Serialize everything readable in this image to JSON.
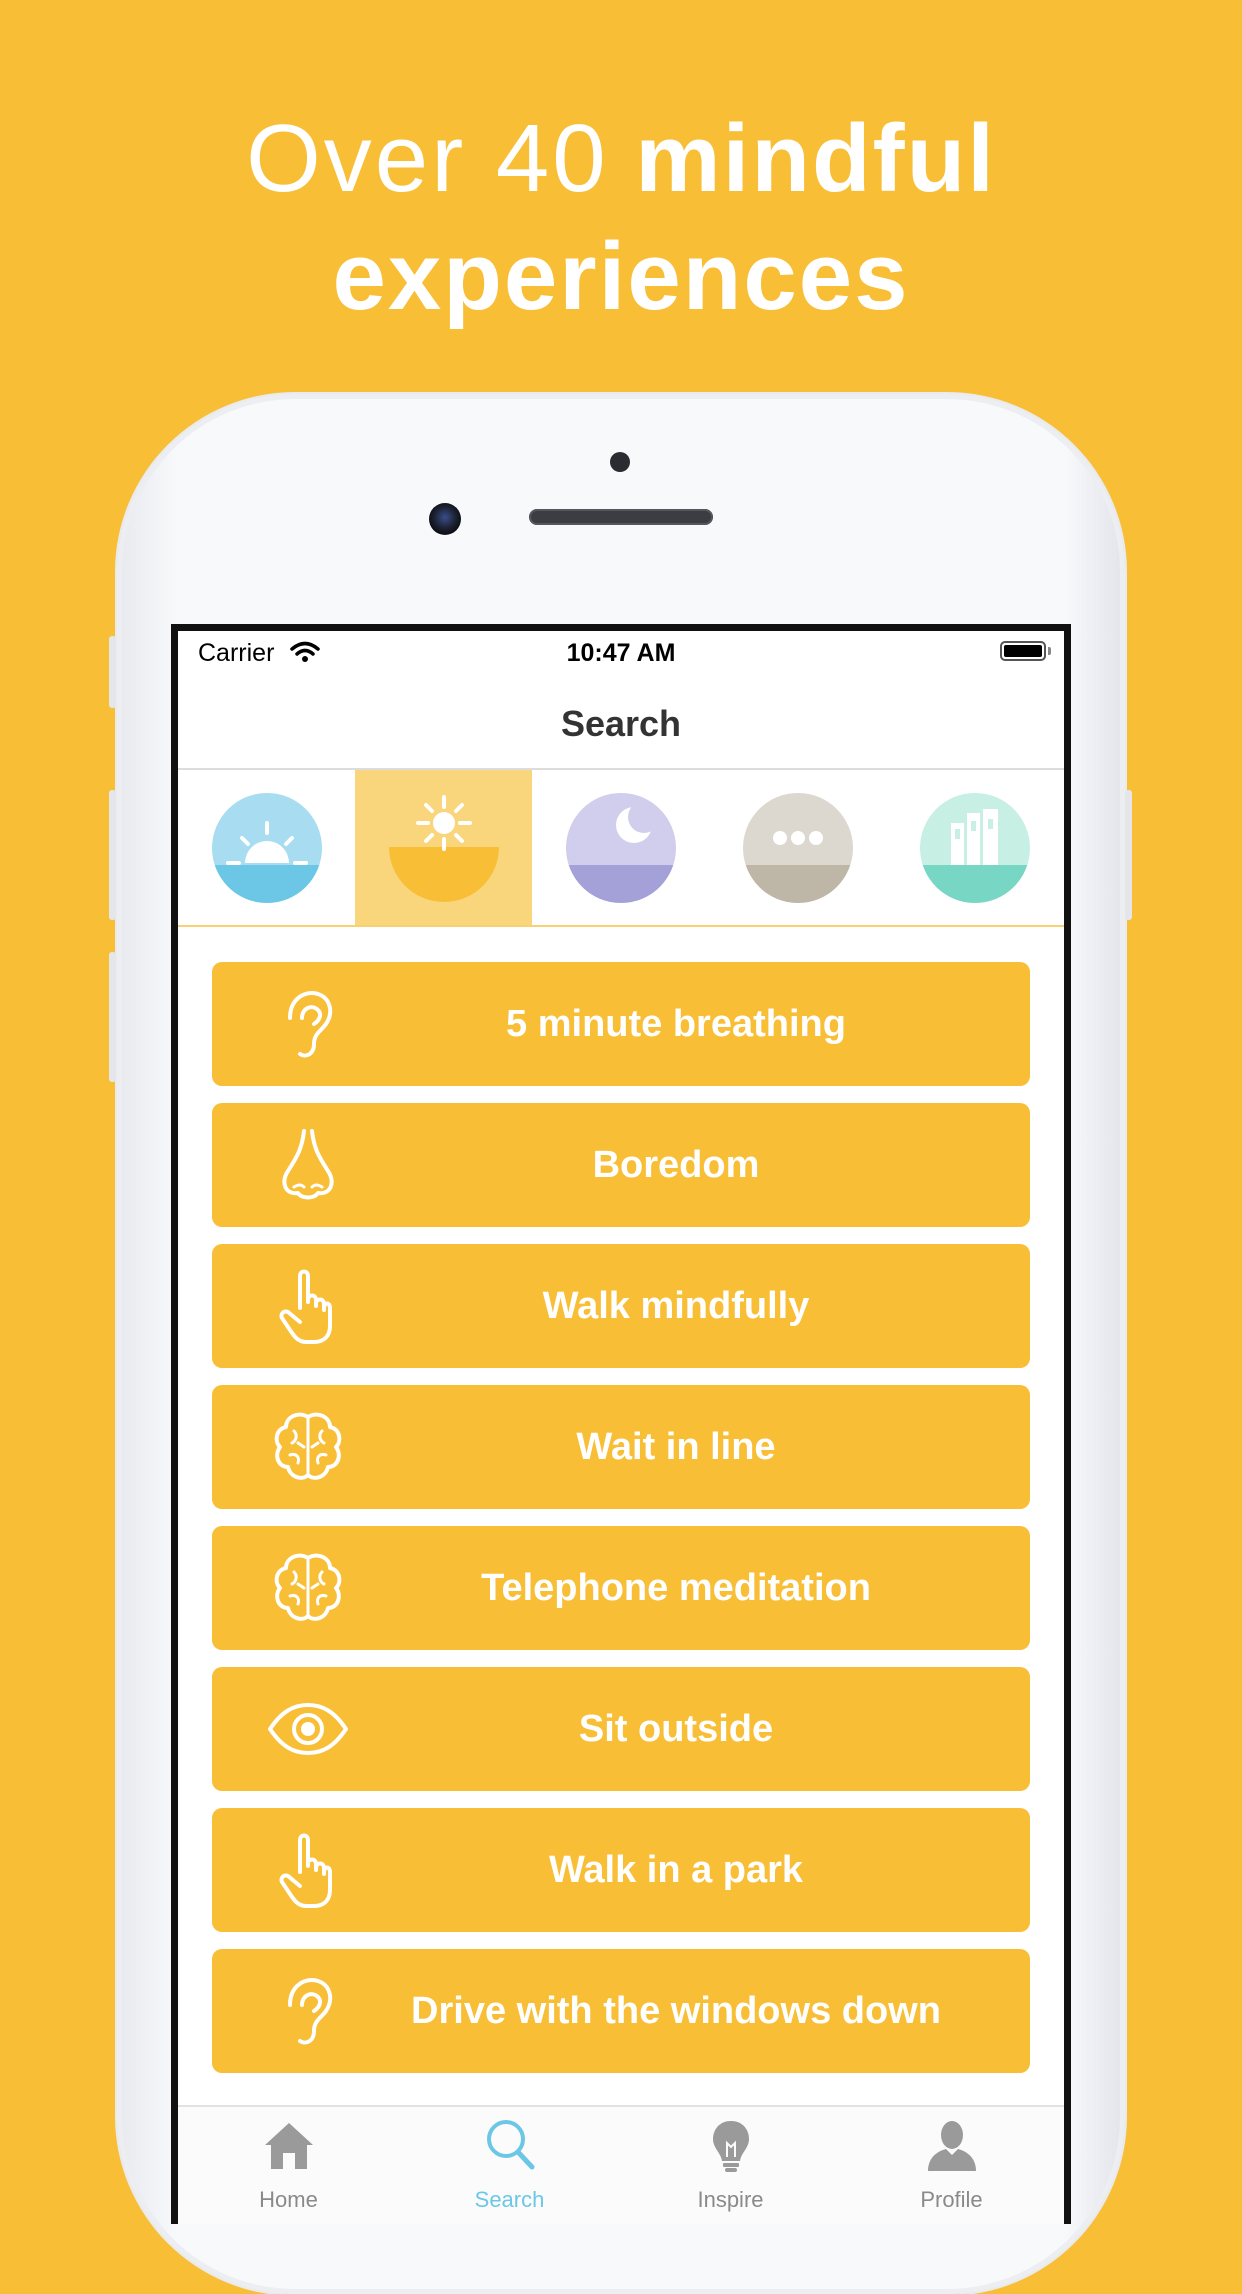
{
  "headline": {
    "light": "Over 40",
    "bold_1": "mindful",
    "bold_2": "experiences"
  },
  "status_bar": {
    "carrier": "Carrier",
    "time": "10:47 AM"
  },
  "nav": {
    "title": "Search"
  },
  "categories": [
    {
      "name": "sunrise",
      "selected": false,
      "top_color": "#A8DCF0",
      "bottom_color": "#6CC7E6"
    },
    {
      "name": "sun",
      "selected": true,
      "top_color": "#F9D57B",
      "bottom_color": "#F8BE36"
    },
    {
      "name": "moon",
      "selected": false,
      "top_color": "#D0CEEC",
      "bottom_color": "#A4A1D8"
    },
    {
      "name": "more",
      "selected": false,
      "top_color": "#DCD8D0",
      "bottom_color": "#BEB6A6"
    },
    {
      "name": "library",
      "selected": false,
      "top_color": "#C7EFE4",
      "bottom_color": "#78D6C4"
    }
  ],
  "items": [
    {
      "label": "5 minute breathing",
      "icon": "ear-icon"
    },
    {
      "label": "Boredom",
      "icon": "nose-icon"
    },
    {
      "label": "Walk mindfully",
      "icon": "hand-icon"
    },
    {
      "label": "Wait in line",
      "icon": "brain-icon"
    },
    {
      "label": "Telephone meditation",
      "icon": "brain-icon"
    },
    {
      "label": "Sit outside",
      "icon": "eye-icon"
    },
    {
      "label": "Walk in a park",
      "icon": "hand-icon"
    },
    {
      "label": "Drive with the windows down",
      "icon": "ear-icon"
    }
  ],
  "tabs": [
    {
      "label": "Home",
      "icon": "home-icon",
      "active": false
    },
    {
      "label": "Search",
      "icon": "search-icon",
      "active": true
    },
    {
      "label": "Inspire",
      "icon": "lightbulb-icon",
      "active": false
    },
    {
      "label": "Profile",
      "icon": "person-icon",
      "active": false
    }
  ],
  "colors": {
    "brand_yellow": "#F8BE36",
    "active_tab": "#6CC7E6",
    "inactive_tab": "#8A8A8A"
  }
}
